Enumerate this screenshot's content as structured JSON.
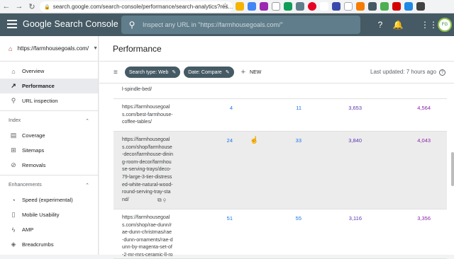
{
  "browser": {
    "url": "search.google.com/search-console/performance/search-analytics?res..."
  },
  "header": {
    "product_name": "Google Search Console",
    "search_placeholder": "Inspect any URL in \"https://farmhousegoals.com/\""
  },
  "sidebar": {
    "property": "https://farmhousegoals.com/",
    "items": [
      {
        "label": "Overview",
        "icon": "home-icon"
      },
      {
        "label": "Performance",
        "icon": "trending-up-icon",
        "active": true
      },
      {
        "label": "URL inspection",
        "icon": "search-icon"
      }
    ],
    "index_header": "Index",
    "index_items": [
      {
        "label": "Coverage",
        "icon": "file-icon"
      },
      {
        "label": "Sitemaps",
        "icon": "sitemap-icon"
      },
      {
        "label": "Removals",
        "icon": "eye-off-icon"
      }
    ],
    "enhancements_header": "Enhancements",
    "enhancement_items": [
      {
        "label": "Speed (experimental)",
        "icon": "speed-icon"
      },
      {
        "label": "Mobile Usability",
        "icon": "phone-icon"
      },
      {
        "label": "AMP",
        "icon": "bolt-icon"
      },
      {
        "label": "Breadcrumbs",
        "icon": "layers-icon"
      }
    ]
  },
  "main": {
    "title": "Performance",
    "chips": [
      {
        "label": "Search type: Web"
      },
      {
        "label": "Date: Compare"
      }
    ],
    "new_label": "NEW",
    "last_updated": "Last updated: 7 hours ago",
    "rows": [
      {
        "url": "l-spindle-bed/",
        "c1": "",
        "c2": "",
        "c3": "",
        "c4": ""
      },
      {
        "url": "https://farmhousegoals.com/best-farmhouse-coffee-tables/",
        "c1": "4",
        "c2": "11",
        "c3": "3,653",
        "c4": "4,564"
      },
      {
        "url": "https://farmhousegoals.com/shop/farmhouse-decor/farmhouse-dining-room-decor/farmhouse-serving-trays/deco-79-large-3-tier-distressed-white-natural-wood-round-serving-tray-stand/",
        "c1": "24",
        "c2": "33",
        "c3": "3,840",
        "c4": "4,043"
      },
      {
        "url": "https://farmhousegoals.com/shop/rae-dunn/rae-dunn-christmas/rae-dunn-ornaments/rae-dunn-by-magenta-set-of-2-mr-mrs-ceramic-ll-rou",
        "c1": "51",
        "c2": "55",
        "c3": "3,116",
        "c4": "3,356"
      }
    ]
  },
  "colors": {
    "appbar": "#455a64",
    "clicks": "#1a73e8",
    "impressions_prev": "#5e35b1",
    "impressions": "#8e24aa"
  }
}
